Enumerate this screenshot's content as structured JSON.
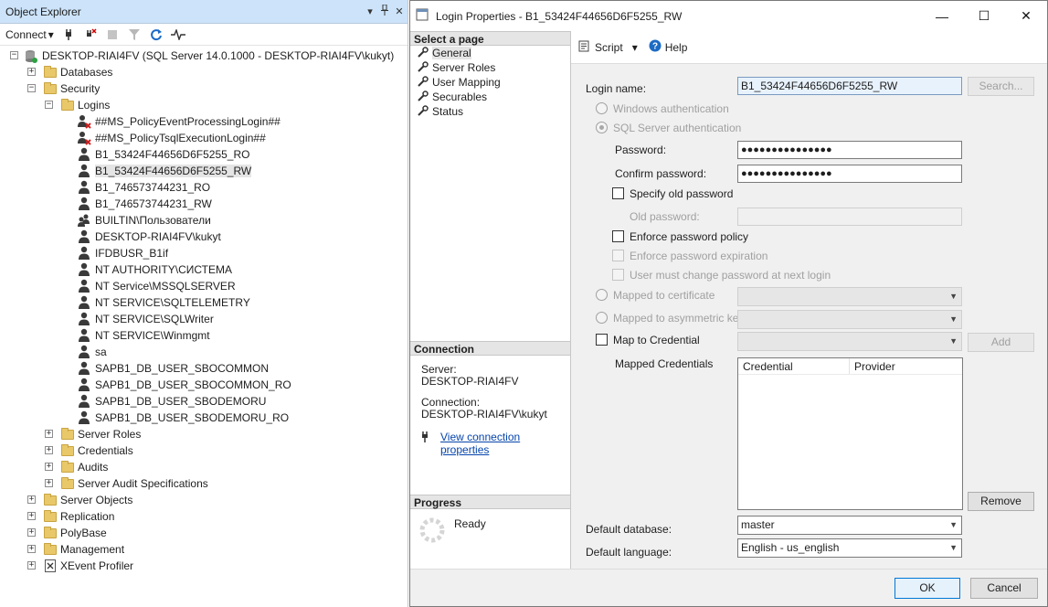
{
  "object_explorer": {
    "title": "Object Explorer",
    "pin_glyph": "❑",
    "close_glyph": "✕",
    "dropdown_glyph": "▾",
    "toolbar": {
      "connect_label": "Connect"
    },
    "tree": {
      "server": "DESKTOP-RIAI4FV (SQL Server 14.0.1000 - DESKTOP-RIAI4FV\\kukyt)",
      "databases": "Databases",
      "security": "Security",
      "logins": "Logins",
      "login_items": [
        "##MS_PolicyEventProcessingLogin##",
        "##MS_PolicyTsqlExecutionLogin##",
        "B1_53424F44656D6F5255_RO",
        "B1_53424F44656D6F5255_RW",
        "B1_746573744231_RO",
        "B1_746573744231_RW",
        "BUILTIN\\Пользователи",
        "DESKTOP-RIAI4FV\\kukyt",
        "IFDBUSR_B1if",
        "NT AUTHORITY\\СИСТЕМА",
        "NT Service\\MSSQLSERVER",
        "NT SERVICE\\SQLTELEMETRY",
        "NT SERVICE\\SQLWriter",
        "NT SERVICE\\Winmgmt",
        "sa",
        "SAPB1_DB_USER_SBOCOMMON",
        "SAPB1_DB_USER_SBOCOMMON_RO",
        "SAPB1_DB_USER_SBODEMORU",
        "SAPB1_DB_USER_SBODEMORU_RO"
      ],
      "security_children": [
        "Server Roles",
        "Credentials",
        "Audits",
        "Server Audit Specifications"
      ],
      "server_children": [
        "Server Objects",
        "Replication",
        "PolyBase",
        "Management",
        "XEvent Profiler"
      ]
    }
  },
  "dialog": {
    "title": "Login Properties - B1_53424F44656D6F5255_RW",
    "window": {
      "minimize": "—",
      "maximize": "☐",
      "close": "✕"
    },
    "select_page_header": "Select a page",
    "pages": [
      "General",
      "Server Roles",
      "User Mapping",
      "Securables",
      "Status"
    ],
    "connection_header": "Connection",
    "server_label": "Server:",
    "server_value": "DESKTOP-RIAI4FV",
    "connection_label": "Connection:",
    "connection_value": "DESKTOP-RIAI4FV\\kukyt",
    "view_connection_link": "View connection properties",
    "progress_header": "Progress",
    "progress_status": "Ready",
    "toolbar": {
      "script": "Script",
      "script_arrow": "▾",
      "help": "Help"
    },
    "form": {
      "login_name_label": "Login name:",
      "login_name_value": "B1_53424F44656D6F5255_RW",
      "search_button": "Search...",
      "windows_auth": "Windows authentication",
      "sql_auth": "SQL Server authentication",
      "password_label": "Password:",
      "password_value": "●●●●●●●●●●●●●●●",
      "confirm_password_label": "Confirm password:",
      "confirm_password_value": "●●●●●●●●●●●●●●●",
      "specify_old_password": "Specify old password",
      "old_password_label": "Old password:",
      "enforce_policy": "Enforce password policy",
      "enforce_expiration": "Enforce password expiration",
      "must_change": "User must change password at next login",
      "mapped_cert": "Mapped to certificate",
      "mapped_asym": "Mapped to asymmetric key",
      "map_credential": "Map to Credential",
      "add_button": "Add",
      "mapped_credentials_label": "Mapped Credentials",
      "cred_columns": [
        "Credential",
        "Provider"
      ],
      "remove_button": "Remove",
      "default_database_label": "Default database:",
      "default_database_value": "master",
      "default_language_label": "Default language:",
      "default_language_value": "English - us_english",
      "dropdown_arrow": "⌵"
    },
    "ok_button": "OK",
    "cancel_button": "Cancel"
  }
}
